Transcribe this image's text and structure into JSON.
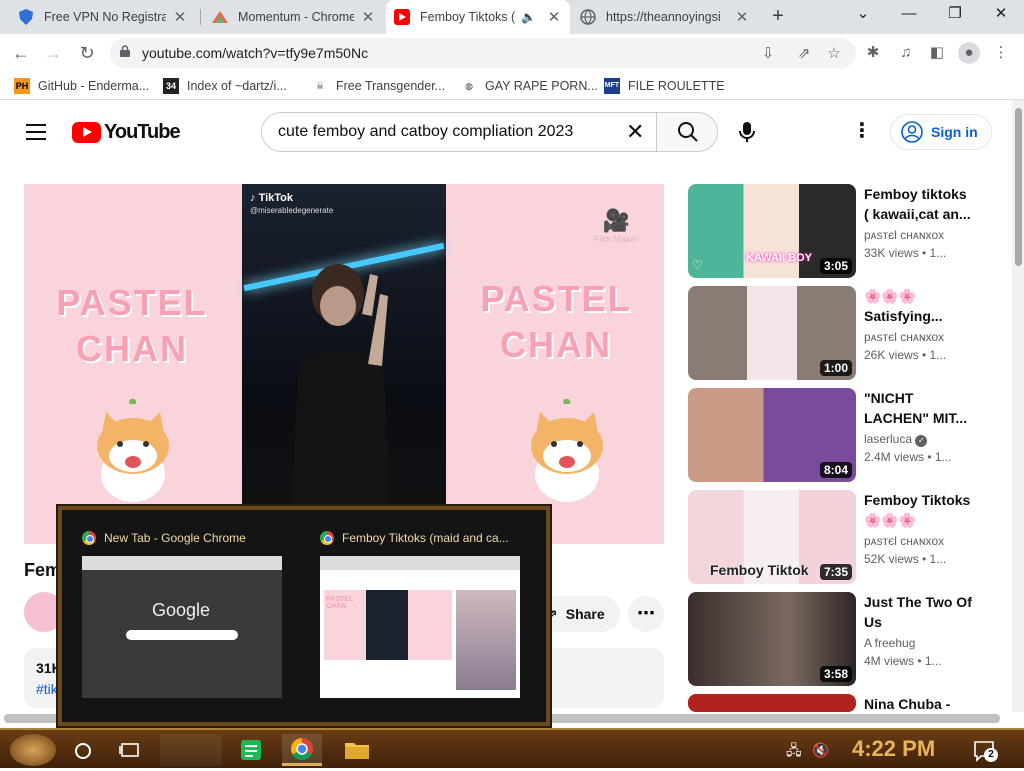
{
  "browser": {
    "tabs": [
      {
        "title": "Free VPN No Registra",
        "active": false
      },
      {
        "title": "Momentum - Chrome W",
        "active": false
      },
      {
        "title": "Femboy Tiktoks (",
        "active": true
      },
      {
        "title": "https://theannoyingsi",
        "active": false
      }
    ],
    "url": "youtube.com/watch?v=tfy9e7m50Nc",
    "bookmarks": [
      {
        "label": "GitHub - Enderma...",
        "icon": "PH"
      },
      {
        "label": "Index of ~dartz/i...",
        "icon": "34"
      },
      {
        "label": "Free Transgender...",
        "icon": "skull"
      },
      {
        "label": "GAY RAPE PORN...",
        "icon": "globe"
      },
      {
        "label": "FILE ROULETTE",
        "icon": "MFT"
      }
    ]
  },
  "youtube": {
    "logo_text": "YouTube",
    "search_value": "cute femboy and catboy compliation 2023",
    "signin_label": "Sign in",
    "video": {
      "title_visible": "Fem",
      "overlay_left_1": "PASTEL",
      "overlay_left_2": "CHAN",
      "overlay_right_1": "PASTEL",
      "overlay_right_2": "CHAN",
      "tiktok_label": "TikTok",
      "tiktok_user": "@miserabledegenerate",
      "film_maker": "Film Maker",
      "share_label": "Share",
      "views_partial": "31K",
      "tags_partial": "#tik"
    },
    "recommendations": [
      {
        "title": "Femboy tiktoks ( kawaii,cat an...",
        "channel": "pᴀsтєl ᴄʜᴀɴxox",
        "meta": "33K views  •  1...",
        "duration": "3:05"
      },
      {
        "title": "🌸🌸🌸 Satisfying...",
        "channel": "pᴀsтєl ᴄʜᴀɴxox",
        "meta": "26K views  •  1...",
        "duration": "1:00"
      },
      {
        "title": "\"NICHT LACHEN\" MIT...",
        "channel": "laserluca",
        "meta": "2.4M views  •  1...",
        "duration": "8:04"
      },
      {
        "title": "Femboy Tiktoks 🌸🌸🌸",
        "channel": "pᴀsтєl ᴄʜᴀɴxox",
        "meta": "52K views  •  1...",
        "duration": "7:35"
      },
      {
        "title": "Just The Two Of Us",
        "channel": "A freehug",
        "meta": "4M views  •  1...",
        "duration": "3:58"
      },
      {
        "title": "Nina Chuba -",
        "channel": "",
        "meta": "",
        "duration": ""
      }
    ],
    "rec_overlay_text_4": "Femboy Tiktok",
    "rec_overlay_text_1": "KAWAII BOY"
  },
  "taskbar": {
    "time": "4:22 PM",
    "notification_count": "2",
    "preview": [
      {
        "title": "New Tab - Google Chrome",
        "content_label": "Google"
      },
      {
        "title": "Femboy Tiktoks (maid and ca...",
        "content_label": "PASTEL CHAN"
      }
    ]
  },
  "colors": {
    "yt_red": "#ff0000",
    "link_blue": "#065fd4",
    "taskbar_brown": "#4e2c0e",
    "clock_gold": "#e8b35a",
    "pastel_pink": "#f9d4db"
  }
}
